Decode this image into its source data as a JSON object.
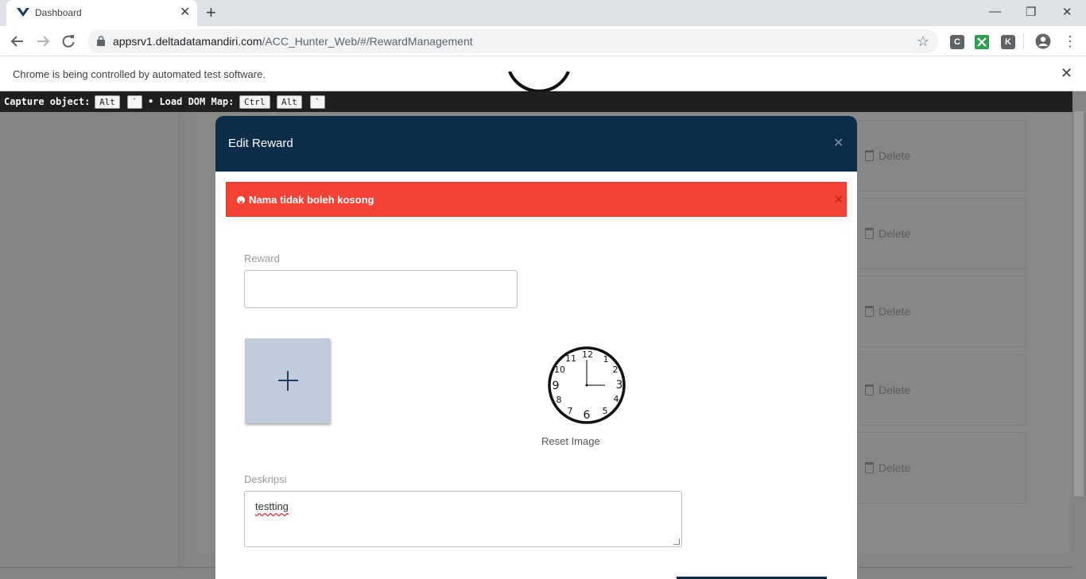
{
  "browser": {
    "tab_title": "Dashboard",
    "url_host": "appsrv1.deltadatamandiri.com",
    "url_path": "/ACC_Hunter_Web/#/RewardManagement",
    "extensions": [
      {
        "letter": "C",
        "color": "#5f6368"
      },
      {
        "letter": "K",
        "color": "#5f6368"
      }
    ],
    "infobar_text": "Chrome is being controlled by automated test software."
  },
  "capture_bar": {
    "capture_label": "Capture object:",
    "capture_keys": [
      "Alt",
      "`"
    ],
    "load_label": "• Load DOM Map:",
    "load_keys": [
      "Ctrl",
      "Alt",
      "`"
    ]
  },
  "background_list": {
    "delete_label": "Delete",
    "rows": [
      "Delete",
      "Delete",
      "Delete",
      "Delete",
      "Delete"
    ]
  },
  "modal": {
    "title": "Edit Reward",
    "alert_text": "Nama tidak boleh kosong",
    "reward_label": "Reward",
    "reward_value": "",
    "reset_image_label": "Reset Image",
    "description_label": "Deskripsi",
    "description_value": "testting",
    "clock_numbers": [
      "12",
      "1",
      "2",
      "3",
      "4",
      "5",
      "6",
      "7",
      "8",
      "9",
      "10",
      "11"
    ]
  },
  "colors": {
    "modal_header": "#0d2c4a",
    "alert": "#f44336",
    "upload_box": "#c0ccd9",
    "overlay": "#848484"
  }
}
